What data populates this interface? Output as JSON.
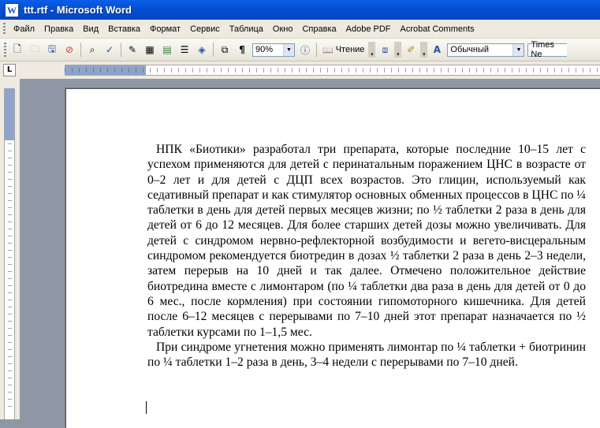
{
  "window": {
    "title": "ttt.rtf - Microsoft Word",
    "app_icon_letter": "W"
  },
  "menu": [
    "Файл",
    "Правка",
    "Вид",
    "Вставка",
    "Формат",
    "Сервис",
    "Таблица",
    "Окно",
    "Справка",
    "Adobe PDF",
    "Acrobat Comments"
  ],
  "toolbar": {
    "zoom": "90%",
    "read_label": "Чтение",
    "style": "Обычный",
    "font": "Times Ne"
  },
  "document": {
    "paragraphs": [
      "НПК «Биотики» разработал три препарата, которые последние 10–15 лет с успехом применяются для детей с перинатальным поражением ЦНС в возрасте от 0–2 лет и для детей с ДЦП всех возрастов. Это глицин, используемый как седативный препарат и как стимулятор основных обменных процессов в ЦНС по ¼ таблетки в день для детей первых месяцев жизни; по ½ таблетки 2 раза в день для детей от 6 до 12 месяцев. Для более старших детей дозы можно увеличивать. Для детей с синдромом нервно-рефлекторной возбудимости и вегето-висцеральным синдромом рекомендуется биотредин в дозах ½ таблетки 2 раза в день 2–3 недели, затем перерыв на 10 дней и так далее. Отмечено положительное действие биотредина вместе с лимонтаром (по ¼ таблетки два раза в день для детей от 0 до 6 мес., после кормления) при состоянии гипомоторного кишечника. Для детей после 6–12 месяцев с перерывами по 7–10 дней этот препарат назначается по ½ таблетки курсами по 1–1,5 мес.",
      "При синдроме угнетения можно применять лимонтар по ¼ таблетки + биотринин по ¼ таблетки 1–2 раза в день, 3–4 недели с перерывами по 7–10 дней."
    ]
  }
}
